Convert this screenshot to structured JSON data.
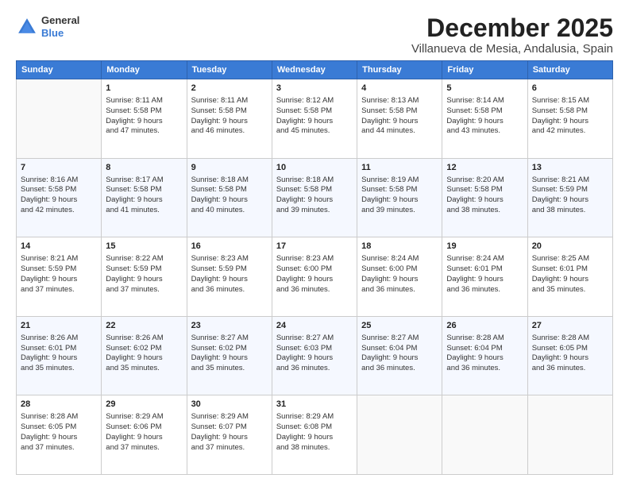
{
  "header": {
    "logo_line1": "General",
    "logo_line2": "Blue",
    "month_title": "December 2025",
    "subtitle": "Villanueva de Mesia, Andalusia, Spain"
  },
  "days_of_week": [
    "Sunday",
    "Monday",
    "Tuesday",
    "Wednesday",
    "Thursday",
    "Friday",
    "Saturday"
  ],
  "weeks": [
    [
      {
        "day": "",
        "info": ""
      },
      {
        "day": "1",
        "info": "Sunrise: 8:11 AM\nSunset: 5:58 PM\nDaylight: 9 hours\nand 47 minutes."
      },
      {
        "day": "2",
        "info": "Sunrise: 8:11 AM\nSunset: 5:58 PM\nDaylight: 9 hours\nand 46 minutes."
      },
      {
        "day": "3",
        "info": "Sunrise: 8:12 AM\nSunset: 5:58 PM\nDaylight: 9 hours\nand 45 minutes."
      },
      {
        "day": "4",
        "info": "Sunrise: 8:13 AM\nSunset: 5:58 PM\nDaylight: 9 hours\nand 44 minutes."
      },
      {
        "day": "5",
        "info": "Sunrise: 8:14 AM\nSunset: 5:58 PM\nDaylight: 9 hours\nand 43 minutes."
      },
      {
        "day": "6",
        "info": "Sunrise: 8:15 AM\nSunset: 5:58 PM\nDaylight: 9 hours\nand 42 minutes."
      }
    ],
    [
      {
        "day": "7",
        "info": "Sunrise: 8:16 AM\nSunset: 5:58 PM\nDaylight: 9 hours\nand 42 minutes."
      },
      {
        "day": "8",
        "info": "Sunrise: 8:17 AM\nSunset: 5:58 PM\nDaylight: 9 hours\nand 41 minutes."
      },
      {
        "day": "9",
        "info": "Sunrise: 8:18 AM\nSunset: 5:58 PM\nDaylight: 9 hours\nand 40 minutes."
      },
      {
        "day": "10",
        "info": "Sunrise: 8:18 AM\nSunset: 5:58 PM\nDaylight: 9 hours\nand 39 minutes."
      },
      {
        "day": "11",
        "info": "Sunrise: 8:19 AM\nSunset: 5:58 PM\nDaylight: 9 hours\nand 39 minutes."
      },
      {
        "day": "12",
        "info": "Sunrise: 8:20 AM\nSunset: 5:58 PM\nDaylight: 9 hours\nand 38 minutes."
      },
      {
        "day": "13",
        "info": "Sunrise: 8:21 AM\nSunset: 5:59 PM\nDaylight: 9 hours\nand 38 minutes."
      }
    ],
    [
      {
        "day": "14",
        "info": "Sunrise: 8:21 AM\nSunset: 5:59 PM\nDaylight: 9 hours\nand 37 minutes."
      },
      {
        "day": "15",
        "info": "Sunrise: 8:22 AM\nSunset: 5:59 PM\nDaylight: 9 hours\nand 37 minutes."
      },
      {
        "day": "16",
        "info": "Sunrise: 8:23 AM\nSunset: 5:59 PM\nDaylight: 9 hours\nand 36 minutes."
      },
      {
        "day": "17",
        "info": "Sunrise: 8:23 AM\nSunset: 6:00 PM\nDaylight: 9 hours\nand 36 minutes."
      },
      {
        "day": "18",
        "info": "Sunrise: 8:24 AM\nSunset: 6:00 PM\nDaylight: 9 hours\nand 36 minutes."
      },
      {
        "day": "19",
        "info": "Sunrise: 8:24 AM\nSunset: 6:01 PM\nDaylight: 9 hours\nand 36 minutes."
      },
      {
        "day": "20",
        "info": "Sunrise: 8:25 AM\nSunset: 6:01 PM\nDaylight: 9 hours\nand 35 minutes."
      }
    ],
    [
      {
        "day": "21",
        "info": "Sunrise: 8:26 AM\nSunset: 6:01 PM\nDaylight: 9 hours\nand 35 minutes."
      },
      {
        "day": "22",
        "info": "Sunrise: 8:26 AM\nSunset: 6:02 PM\nDaylight: 9 hours\nand 35 minutes."
      },
      {
        "day": "23",
        "info": "Sunrise: 8:27 AM\nSunset: 6:02 PM\nDaylight: 9 hours\nand 35 minutes."
      },
      {
        "day": "24",
        "info": "Sunrise: 8:27 AM\nSunset: 6:03 PM\nDaylight: 9 hours\nand 36 minutes."
      },
      {
        "day": "25",
        "info": "Sunrise: 8:27 AM\nSunset: 6:04 PM\nDaylight: 9 hours\nand 36 minutes."
      },
      {
        "day": "26",
        "info": "Sunrise: 8:28 AM\nSunset: 6:04 PM\nDaylight: 9 hours\nand 36 minutes."
      },
      {
        "day": "27",
        "info": "Sunrise: 8:28 AM\nSunset: 6:05 PM\nDaylight: 9 hours\nand 36 minutes."
      }
    ],
    [
      {
        "day": "28",
        "info": "Sunrise: 8:28 AM\nSunset: 6:05 PM\nDaylight: 9 hours\nand 37 minutes."
      },
      {
        "day": "29",
        "info": "Sunrise: 8:29 AM\nSunset: 6:06 PM\nDaylight: 9 hours\nand 37 minutes."
      },
      {
        "day": "30",
        "info": "Sunrise: 8:29 AM\nSunset: 6:07 PM\nDaylight: 9 hours\nand 37 minutes."
      },
      {
        "day": "31",
        "info": "Sunrise: 8:29 AM\nSunset: 6:08 PM\nDaylight: 9 hours\nand 38 minutes."
      },
      {
        "day": "",
        "info": ""
      },
      {
        "day": "",
        "info": ""
      },
      {
        "day": "",
        "info": ""
      }
    ]
  ]
}
